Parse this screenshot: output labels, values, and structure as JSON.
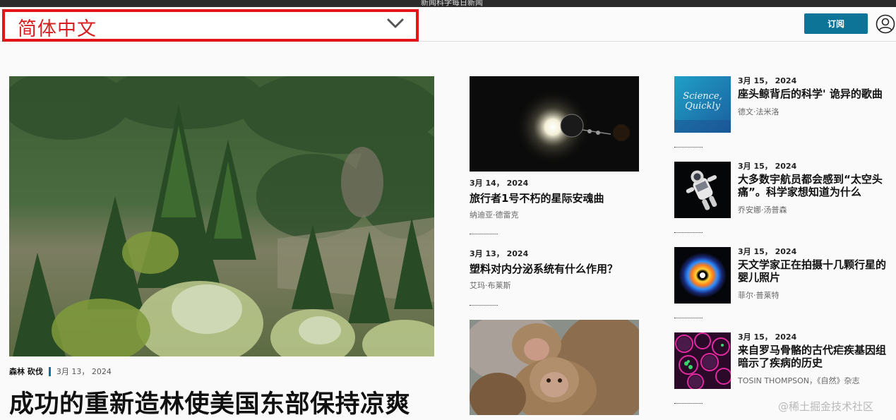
{
  "top_strip": {
    "text": "新闻科学每日新闻"
  },
  "header": {
    "language": "简体中文",
    "subscribe_label": "订阅"
  },
  "lead": {
    "category": "森林 砍伐",
    "date": "3月 13， 2024",
    "title": "成功的重新造林使美国东部保持凉爽"
  },
  "middle": [
    {
      "date": "3月 14， 2024",
      "title": "旅行者1号不朽的星际安魂曲",
      "author": "纳迪亚·德雷克"
    },
    {
      "date": "3月 13， 2024",
      "title": "塑料对内分泌系统有什么作用？",
      "author": "艾玛·布莱斯"
    }
  ],
  "right": [
    {
      "date": "3月 15， 2024",
      "title": "座头鲸背后的科学' 诡异的歌曲",
      "author": "德文·法米洛",
      "thumb_text": "Science, Quickly"
    },
    {
      "date": "3月 15， 2024",
      "title": "大多数宇航员都会感到“太空头痛”。科学家想知道为什么",
      "author": "乔安娜·汤普森"
    },
    {
      "date": "3月 15， 2024",
      "title": "天文学家正在拍摄十几颗行星的婴儿照片",
      "author": "菲尔·普莱特"
    },
    {
      "date": "3月 15， 2024",
      "title": "来自罗马骨骼的古代疟疾基因组暗示了疾病的历史",
      "author": "TOSIN THOMPSON，《自然》杂志"
    }
  ],
  "watermark": "@稀土掘金技术社区",
  "icons": {
    "chevron": "chevron-down-icon",
    "user": "user-account-icon"
  },
  "colors": {
    "accent": "#0e7497",
    "highlight_border": "#e3141b",
    "language_text": "#d92020"
  }
}
